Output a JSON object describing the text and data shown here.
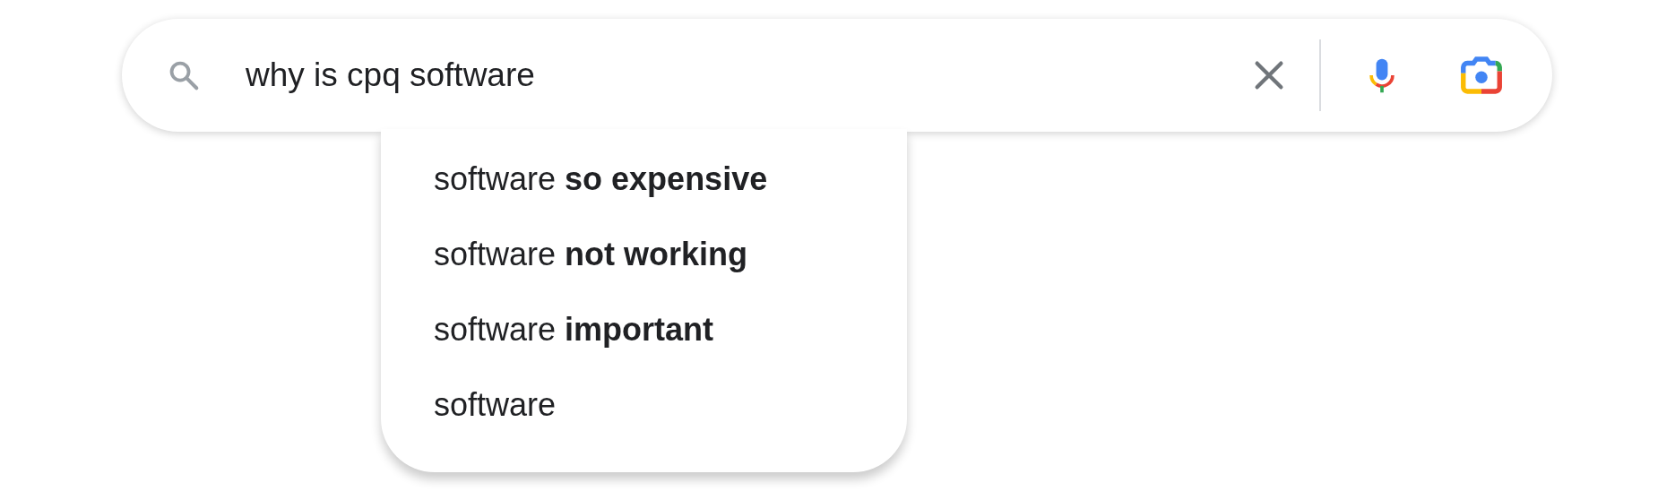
{
  "search": {
    "value": "why is cpq software"
  },
  "suggestions": [
    {
      "text": "software **so expensive**"
    },
    {
      "text": "software **not working**"
    },
    {
      "text": "software **important**"
    },
    {
      "text": "software"
    }
  ]
}
